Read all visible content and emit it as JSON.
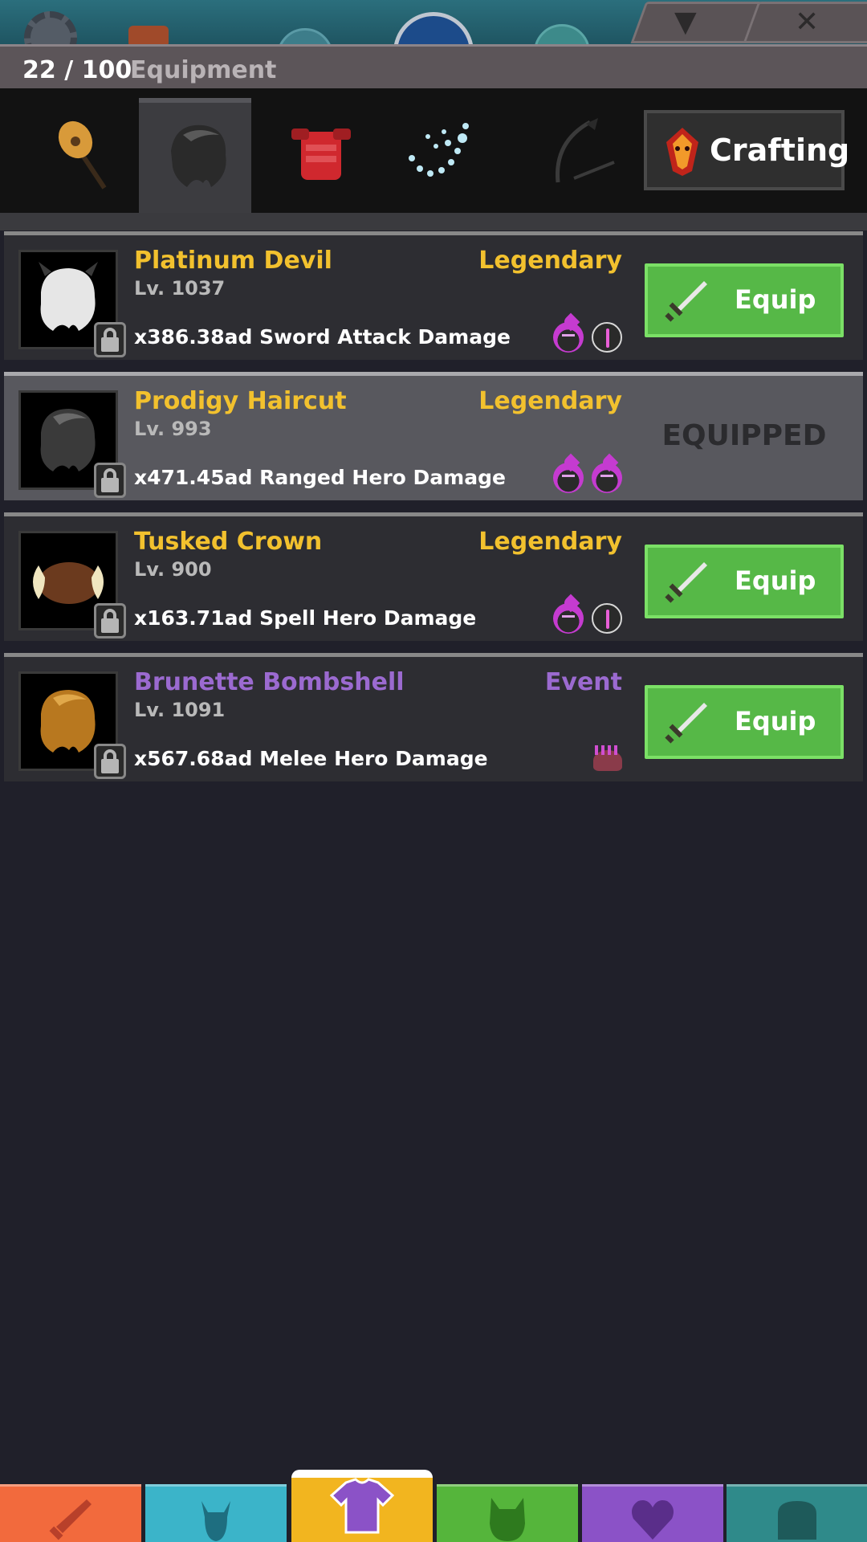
{
  "window": {
    "header_count": "22 / 100",
    "header_label": "Equipment",
    "crafting_label": "Crafting"
  },
  "categories": [
    {
      "name": "guitar-icon",
      "active": false
    },
    {
      "name": "hair-icon",
      "active": true
    },
    {
      "name": "armor-icon",
      "active": false
    },
    {
      "name": "sparkle-icon",
      "active": false
    },
    {
      "name": "scythe-icon",
      "active": false
    }
  ],
  "items": [
    {
      "name": "Platinum Devil",
      "rarity": "Legendary",
      "level": "Lv. 1037",
      "stat": "x386.38ad Sword Attack Damage",
      "action": "Equip",
      "hair_color": "#e6e6e6",
      "badges": [
        "flame-devil-badge-icon",
        "sword-badge-icon"
      ]
    },
    {
      "name": "Prodigy Haircut",
      "rarity": "Legendary",
      "level": "Lv. 993",
      "stat": "x471.45ad Ranged Hero Damage",
      "action": "EQUIPPED",
      "hair_color": "#3a3a3a",
      "badges": [
        "flame-devil-badge-icon",
        "flame-sad-badge-icon"
      ]
    },
    {
      "name": "Tusked Crown",
      "rarity": "Legendary",
      "level": "Lv. 900",
      "stat": "x163.71ad Spell Hero Damage",
      "action": "Equip",
      "hair_color": "#6b3a1e",
      "badges": [
        "flame-sad-badge-icon",
        "sword-badge-icon"
      ]
    },
    {
      "name": "Brunette Bombshell",
      "rarity": "Event",
      "level": "Lv. 1091",
      "stat": "x567.68ad Melee Hero Damage",
      "action": "Equip",
      "hair_color": "#b8781f",
      "badges": [
        "hedgehog-badge-icon"
      ]
    }
  ],
  "bottom_nav": [
    {
      "name": "sword-nav-icon",
      "color": "#f26a3d",
      "active": false
    },
    {
      "name": "viking-nav-icon",
      "color": "#3bb4c9",
      "active": false
    },
    {
      "name": "shirt-nav-icon",
      "color": "#f2b51f",
      "active": true
    },
    {
      "name": "cat-nav-icon",
      "color": "#55b53b",
      "active": false
    },
    {
      "name": "heart-nav-icon",
      "color": "#8b52c7",
      "active": false
    },
    {
      "name": "chest-nav-icon",
      "color": "#2f8a8a",
      "active": false
    }
  ],
  "colors": {
    "legendary": "#f2c12e",
    "event": "#9b6ad0",
    "equip_green": "#56b847"
  }
}
